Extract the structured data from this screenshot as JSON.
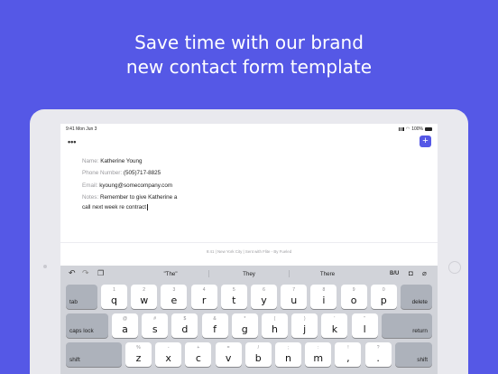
{
  "headline": {
    "line1": "Save time with our brand",
    "line2": "new contact form template"
  },
  "status_bar": {
    "time": "9:41  Mon Jun 3",
    "battery": "100%"
  },
  "toolbar": {
    "more_label": "•••",
    "add_label": "+"
  },
  "form": {
    "name_label": "Name:",
    "name_value": "Katherine Young",
    "phone_label": "Phone Number:",
    "phone_value": "(505)717-8825",
    "email_label": "Email:",
    "email_value": "kyoung@somecompany.com",
    "notes_label": "Notes:",
    "notes_line1": "Remember to give Katherine a",
    "notes_line2": "call next week re contract"
  },
  "footer": {
    "text": "9:41 | New York City | Sent with Flite - By Fueled"
  },
  "keyboard": {
    "suggestions": [
      "\"The\"",
      "They",
      "There"
    ],
    "format_label": "B/U",
    "row1": [
      {
        "alt": "1",
        "main": "q"
      },
      {
        "alt": "2",
        "main": "w"
      },
      {
        "alt": "3",
        "main": "e"
      },
      {
        "alt": "4",
        "main": "r"
      },
      {
        "alt": "5",
        "main": "t"
      },
      {
        "alt": "6",
        "main": "y"
      },
      {
        "alt": "7",
        "main": "u"
      },
      {
        "alt": "8",
        "main": "i"
      },
      {
        "alt": "9",
        "main": "o"
      },
      {
        "alt": "0",
        "main": "p"
      }
    ],
    "row2": [
      {
        "alt": "@",
        "main": "a"
      },
      {
        "alt": "#",
        "main": "s"
      },
      {
        "alt": "$",
        "main": "d"
      },
      {
        "alt": "&",
        "main": "f"
      },
      {
        "alt": "*",
        "main": "g"
      },
      {
        "alt": "(",
        "main": "h"
      },
      {
        "alt": ")",
        "main": "j"
      },
      {
        "alt": "'",
        "main": "k"
      },
      {
        "alt": "\"",
        "main": "l"
      }
    ],
    "row3": [
      {
        "alt": "%",
        "main": "z"
      },
      {
        "alt": "-",
        "main": "x"
      },
      {
        "alt": "+",
        "main": "c"
      },
      {
        "alt": "=",
        "main": "v"
      },
      {
        "alt": "/",
        "main": "b"
      },
      {
        "alt": ";",
        "main": "n"
      },
      {
        "alt": ":",
        "main": "m"
      },
      {
        "alt": "!",
        "main": ","
      },
      {
        "alt": "?",
        "main": "."
      }
    ],
    "tab_label": "tab",
    "delete_label": "delete",
    "caps_label": "caps lock",
    "return_label": "return",
    "shift_label": "shift"
  }
}
